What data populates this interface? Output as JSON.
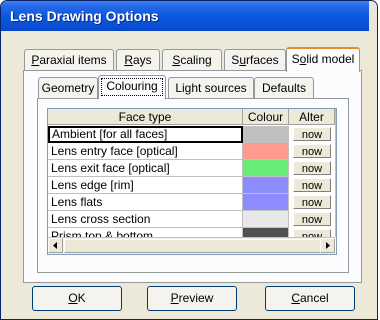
{
  "window": {
    "title": "Lens Drawing Options"
  },
  "outer_tabs": [
    {
      "pre": "",
      "key": "P",
      "post": "araxial items",
      "active": false
    },
    {
      "pre": "",
      "key": "R",
      "post": "ays",
      "active": false
    },
    {
      "pre": "",
      "key": "S",
      "post": "caling",
      "active": false
    },
    {
      "pre": "S",
      "key": "u",
      "post": "rfaces",
      "active": false
    },
    {
      "pre": "S",
      "key": "o",
      "post": "lid model",
      "active": true
    }
  ],
  "inner_tabs": [
    {
      "label": "Geometry",
      "active": false
    },
    {
      "label": "Colouring",
      "active": true
    },
    {
      "label": "Light sources",
      "active": false
    },
    {
      "label": "Defaults",
      "active": false
    }
  ],
  "grid": {
    "headers": {
      "face_type": "Face type",
      "colour": "Colour",
      "alter": "Alter"
    },
    "rows": [
      {
        "name": "Ambient [for all faces]",
        "colour": "#c0c0c0",
        "alter": "now",
        "selected": true
      },
      {
        "name": "Lens entry face [optical]",
        "colour": "#ff9a8c",
        "alter": "now",
        "selected": false
      },
      {
        "name": "Lens exit face [optical]",
        "colour": "#66ee77",
        "alter": "now",
        "selected": false
      },
      {
        "name": "Lens edge [rim]",
        "colour": "#8c8cff",
        "alter": "now",
        "selected": false
      },
      {
        "name": "Lens flats",
        "colour": "#8c8cff",
        "alter": "now",
        "selected": false
      },
      {
        "name": "Lens cross section",
        "colour": "#e8e8e8",
        "alter": "now",
        "selected": false
      },
      {
        "name": "Prism top & bottom",
        "colour": "#505050",
        "alter": "now",
        "selected": false
      }
    ]
  },
  "buttons": {
    "ok": {
      "key": "O",
      "post": "K"
    },
    "preview": {
      "key": "P",
      "post": "review"
    },
    "cancel": {
      "key": "C",
      "post": "ancel"
    }
  }
}
